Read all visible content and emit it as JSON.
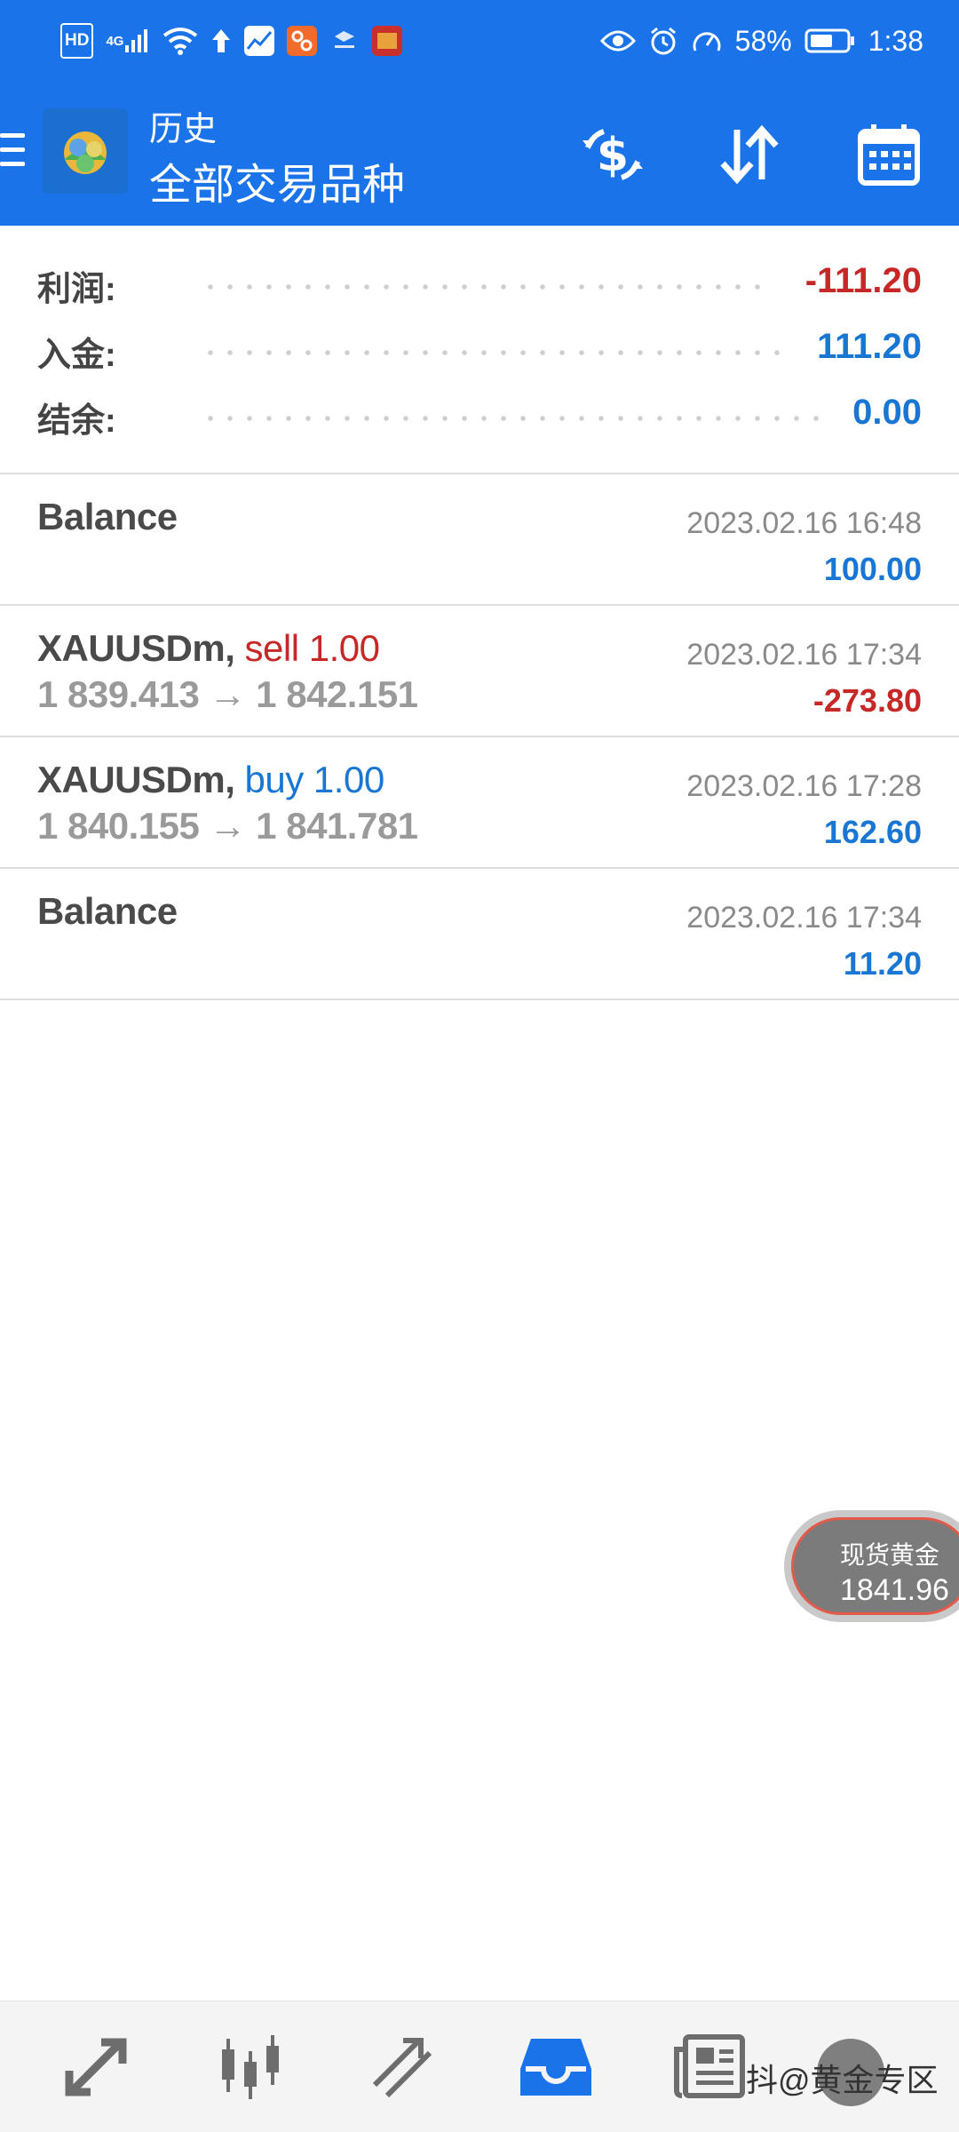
{
  "status_bar": {
    "hd": "HD",
    "network": "4G",
    "battery_percent": "58%",
    "time": "1:38"
  },
  "header": {
    "subtitle": "历史",
    "title": "全部交易品种",
    "icons": [
      "menu-icon",
      "app-logo",
      "currency-exchange-icon",
      "sort-icon",
      "calendar-icon"
    ]
  },
  "summary": {
    "profit_label": "利润:",
    "profit_value": "-111.20",
    "deposit_label": "入金:",
    "deposit_value": "111.20",
    "balance_label": "结余:",
    "balance_value": "0.00"
  },
  "deals": [
    {
      "title": "Balance",
      "time": "2023.02.16 16:48",
      "amount": "100.00"
    },
    {
      "symbol": "XAUUSDm,",
      "action": "sell 1.00",
      "prices": "1 839.413 → 1 842.151",
      "time": "2023.02.16 17:34",
      "amount": "-273.80"
    },
    {
      "symbol": "XAUUSDm,",
      "action": "buy 1.00",
      "prices": "1 840.155 → 1 841.781",
      "time": "2023.02.16 17:28",
      "amount": "162.60"
    },
    {
      "title": "Balance",
      "time": "2023.02.16 17:34",
      "amount": "11.20"
    }
  ],
  "price_badge": {
    "label": "现货黄金",
    "value": "1841.96"
  },
  "bottom_nav": {
    "items": [
      "quotes-icon",
      "chart-icon",
      "trade-icon",
      "history-icon",
      "news-icon"
    ],
    "active": "history-icon",
    "watermark": "抖@黄金专区"
  },
  "colors": {
    "app_bar": "#1a73e8",
    "negative": "#c62828",
    "positive": "#1976d2",
    "active_nav": "#1a73e8"
  }
}
